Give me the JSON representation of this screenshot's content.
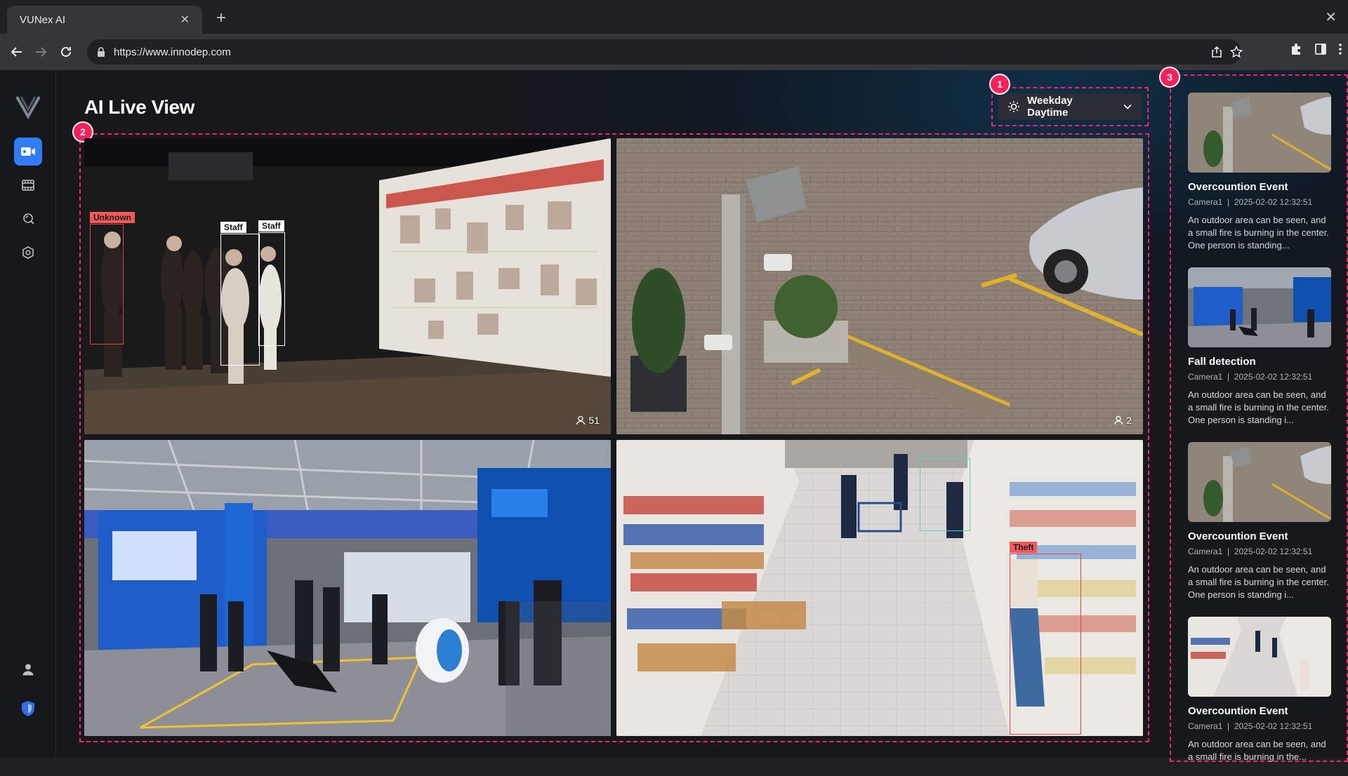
{
  "browser": {
    "tab_title": "VUNex AI",
    "url": "https://www.innodep.com"
  },
  "page": {
    "title": "AI Live View"
  },
  "mode_select": {
    "label": "Weekday Daytime"
  },
  "badges": [
    "1",
    "2",
    "3"
  ],
  "sidebar": {
    "items": [
      {
        "icon": "live-view-icon",
        "active": true
      },
      {
        "icon": "playback-icon",
        "active": false
      },
      {
        "icon": "search-icon",
        "active": false
      },
      {
        "icon": "settings-icon",
        "active": false
      }
    ],
    "bottom": [
      {
        "icon": "user-icon"
      },
      {
        "icon": "shield-icon"
      }
    ]
  },
  "cameras": [
    {
      "scene": "exhibition-hall",
      "count": "51",
      "detections": [
        {
          "label": "Unknown",
          "color": "red"
        },
        {
          "label": "Staff",
          "color": "white"
        },
        {
          "label": "Staff",
          "color": "white"
        }
      ]
    },
    {
      "scene": "parking-lot",
      "count": "2",
      "detections": []
    },
    {
      "scene": "trade-show-floor",
      "count": "",
      "detections": []
    },
    {
      "scene": "supermarket-aisle",
      "count": "",
      "detections": [
        {
          "label": "Theft",
          "color": "red"
        }
      ]
    }
  ],
  "events": [
    {
      "title": "Overcountion Event",
      "camera": "Camera1",
      "time": "2025-02-02 12:32:51",
      "description": "An outdoor area can be seen, and a small fire is burning in the center. One person is standing..."
    },
    {
      "title": "Fall detection",
      "camera": "Camera1",
      "time": "2025-02-02 12:32:51",
      "description": "An outdoor area can be seen, and a small fire is burning in the center. One person is standing i..."
    },
    {
      "title": "Overcountion Event",
      "camera": "Camera1",
      "time": "2025-02-02 12:32:51",
      "description": "An outdoor area can be seen, and a small fire is burning in the center. One person is standing i..."
    },
    {
      "title": "Overcountion Event",
      "camera": "Camera1",
      "time": "2025-02-02 12:32:51",
      "description": "An outdoor area can be seen, and a small fire is burning in the..."
    }
  ],
  "colors": {
    "accent": "#2f7cf6",
    "highlight": "#ff1f6b",
    "detection_red": "#f05a5a"
  }
}
